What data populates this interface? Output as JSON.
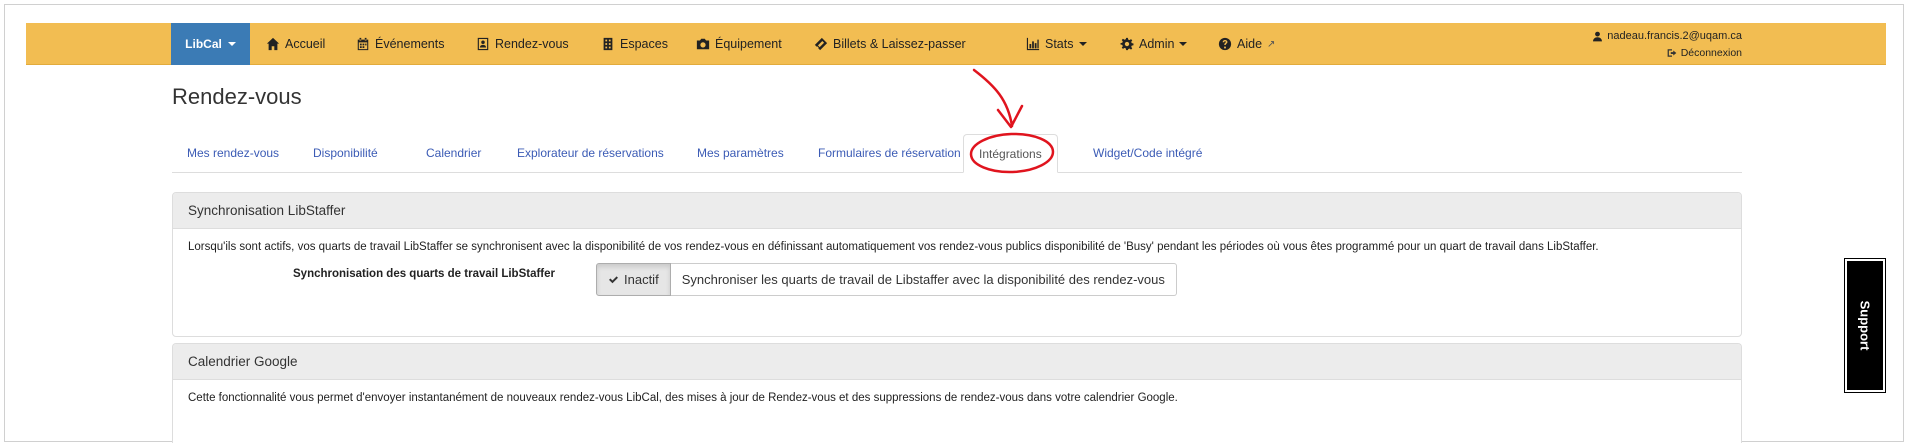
{
  "navbar": {
    "brand": "LibCal",
    "items": [
      {
        "label": "Accueil",
        "icon": "home-icon"
      },
      {
        "label": "Événements",
        "icon": "calendar-icon"
      },
      {
        "label": "Rendez-vous",
        "icon": "contact-card-icon"
      },
      {
        "label": "Espaces",
        "icon": "building-icon"
      },
      {
        "label": "Équipement",
        "icon": "camera-icon"
      },
      {
        "label": "Billets & Laissez-passer",
        "icon": "ticket-icon"
      },
      {
        "label": "Stats",
        "icon": "bar-chart-icon"
      },
      {
        "label": "Admin",
        "icon": "gear-icon"
      },
      {
        "label": "Aide",
        "icon": "question-circle-icon"
      }
    ],
    "user": "nadeau.francis.2@uqam.ca",
    "logout": "Déconnexion",
    "colors": {
      "bar": "#f2bd52",
      "brand": "#3b7bb5"
    }
  },
  "page": {
    "title": "Rendez-vous"
  },
  "tabs": [
    "Mes rendez-vous",
    "Disponibilité",
    "Calendrier",
    "Explorateur de réservations",
    "Mes paramètres",
    "Formulaires de réservation",
    "Intégrations",
    "Widget/Code intégré"
  ],
  "active_tab": "Intégrations",
  "libstaffer": {
    "heading": "Synchronisation LibStaffer",
    "description": "Lorsqu'ils sont actifs, vos quarts de travail LibStaffer se synchronisent avec la disponibilité de vos rendez-vous en définissant automatiquement vos rendez-vous publics disponibilité de 'Busy' pendant les périodes où vous êtes programmé pour un quart de travail dans LibStaffer.",
    "setting_label": "Synchronisation des quarts de travail LibStaffer",
    "inactive_label": "Inactif",
    "sync_label": "Synchroniser les quarts de travail de Libstaffer avec la disponibilité des rendez-vous"
  },
  "google": {
    "heading": "Calendrier Google",
    "description": "Cette fonctionnalité vous permet d'envoyer instantanément de nouveaux rendez-vous LibCal, des mises à jour de Rendez-vous et des suppressions de rendez-vous dans votre calendrier Google."
  },
  "support": {
    "label": "Support"
  },
  "annotation_color": "#e0141e"
}
